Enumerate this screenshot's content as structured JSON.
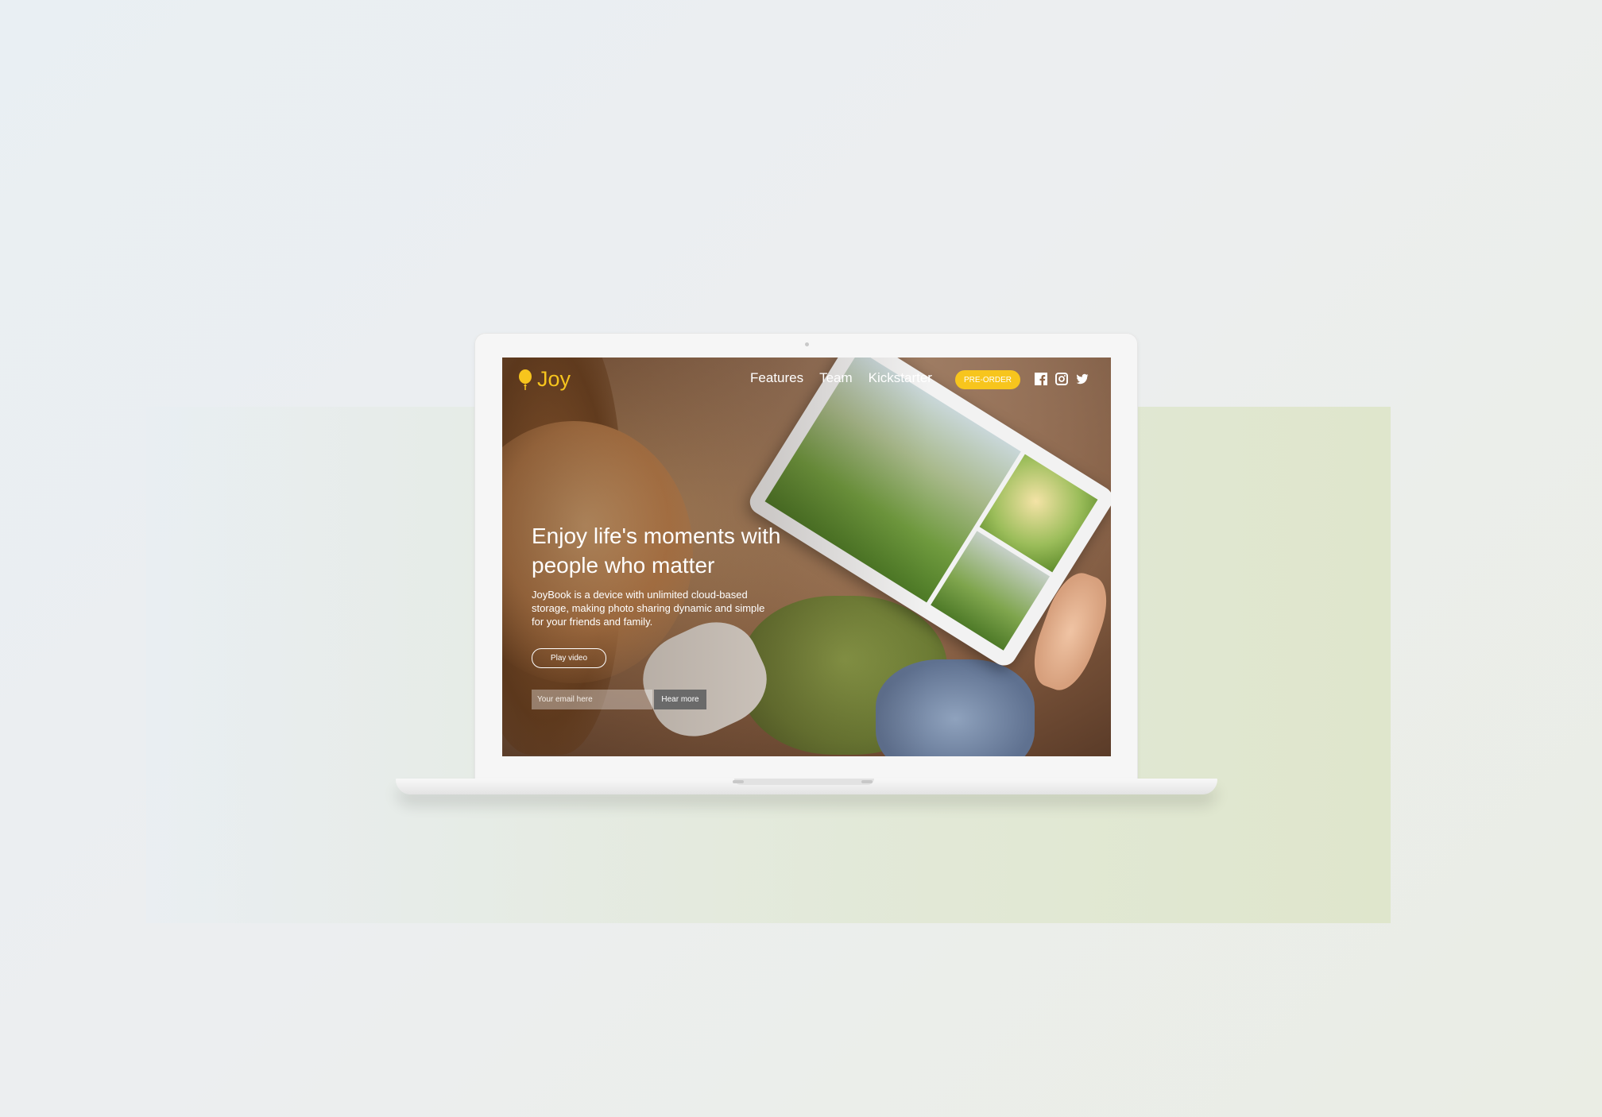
{
  "site": {
    "logo_text": "Joy",
    "brand_color": "#f7c51d",
    "nav": [
      {
        "label": "Features"
      },
      {
        "label": "Team"
      },
      {
        "label": "Kickstarter"
      }
    ],
    "preorder_label": "PRE-ORDER",
    "social_icons": [
      "facebook-icon",
      "instagram-icon",
      "twitter-icon"
    ]
  },
  "hero": {
    "headline_line1": "Enjoy life's moments with",
    "headline_line2": "people who matter",
    "description": "JoyBook is a device with unlimited cloud-based storage, making photo sharing dynamic and simple for your friends and family.",
    "play_video_label": "Play video",
    "email_placeholder": "Your email here",
    "hear_more_label": "Hear more"
  }
}
